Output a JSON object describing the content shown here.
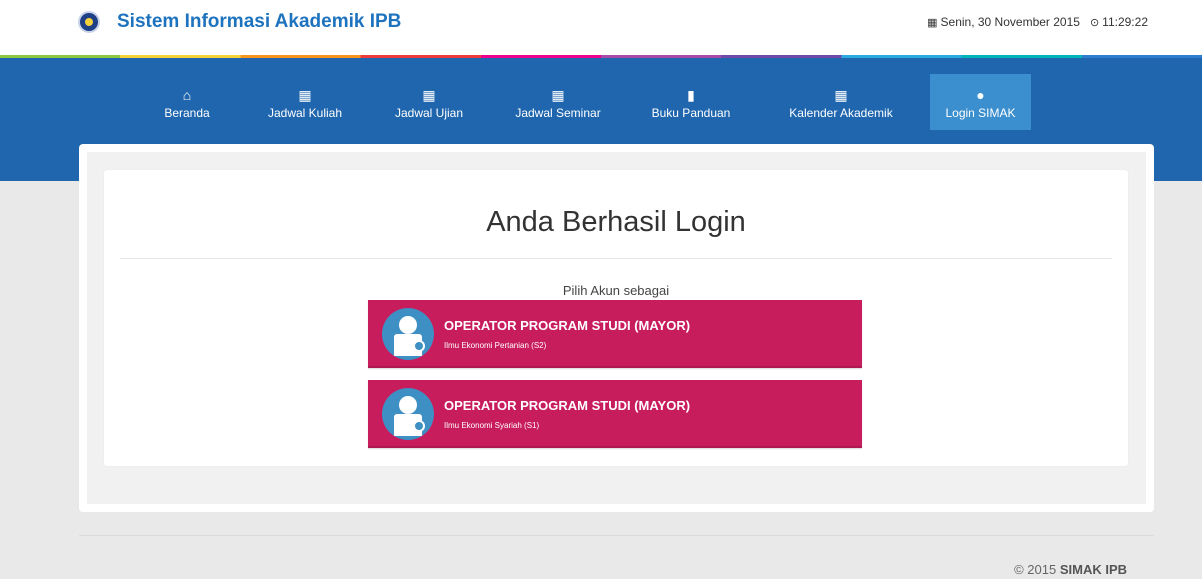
{
  "header": {
    "title": "Sistem Informasi Akademik IPB",
    "date": "Senin, 30 November 2015",
    "time": "11:29:22"
  },
  "nav": {
    "items": [
      {
        "label": "Beranda",
        "icon": "home-icon"
      },
      {
        "label": "Jadwal Kuliah",
        "icon": "calendar-icon"
      },
      {
        "label": "Jadwal Ujian",
        "icon": "calendar-icon"
      },
      {
        "label": "Jadwal Seminar",
        "icon": "calendar-icon"
      },
      {
        "label": "Buku Panduan",
        "icon": "book-icon"
      },
      {
        "label": "Kalender Akademik",
        "icon": "calendar-icon"
      },
      {
        "label": "Login SIMAK",
        "icon": "user-icon"
      }
    ]
  },
  "main": {
    "heading": "Anda Berhasil Login",
    "subtitle": "Pilih Akun sebagai",
    "accounts": [
      {
        "role": "OPERATOR PROGRAM STUDI (MAYOR)",
        "program": "Ilmu Ekonomi Pertanian (S2)"
      },
      {
        "role": "OPERATOR PROGRAM STUDI (MAYOR)",
        "program": "Ilmu Ekonomi Syariah (S1)"
      }
    ]
  },
  "footer": {
    "year": "© 2015",
    "brand": "SIMAK IPB"
  },
  "colors": {
    "nav_bg": "#1f66ae",
    "nav_active": "#3b8fcf",
    "account_bg": "#c81d5d",
    "title": "#1e73be"
  }
}
